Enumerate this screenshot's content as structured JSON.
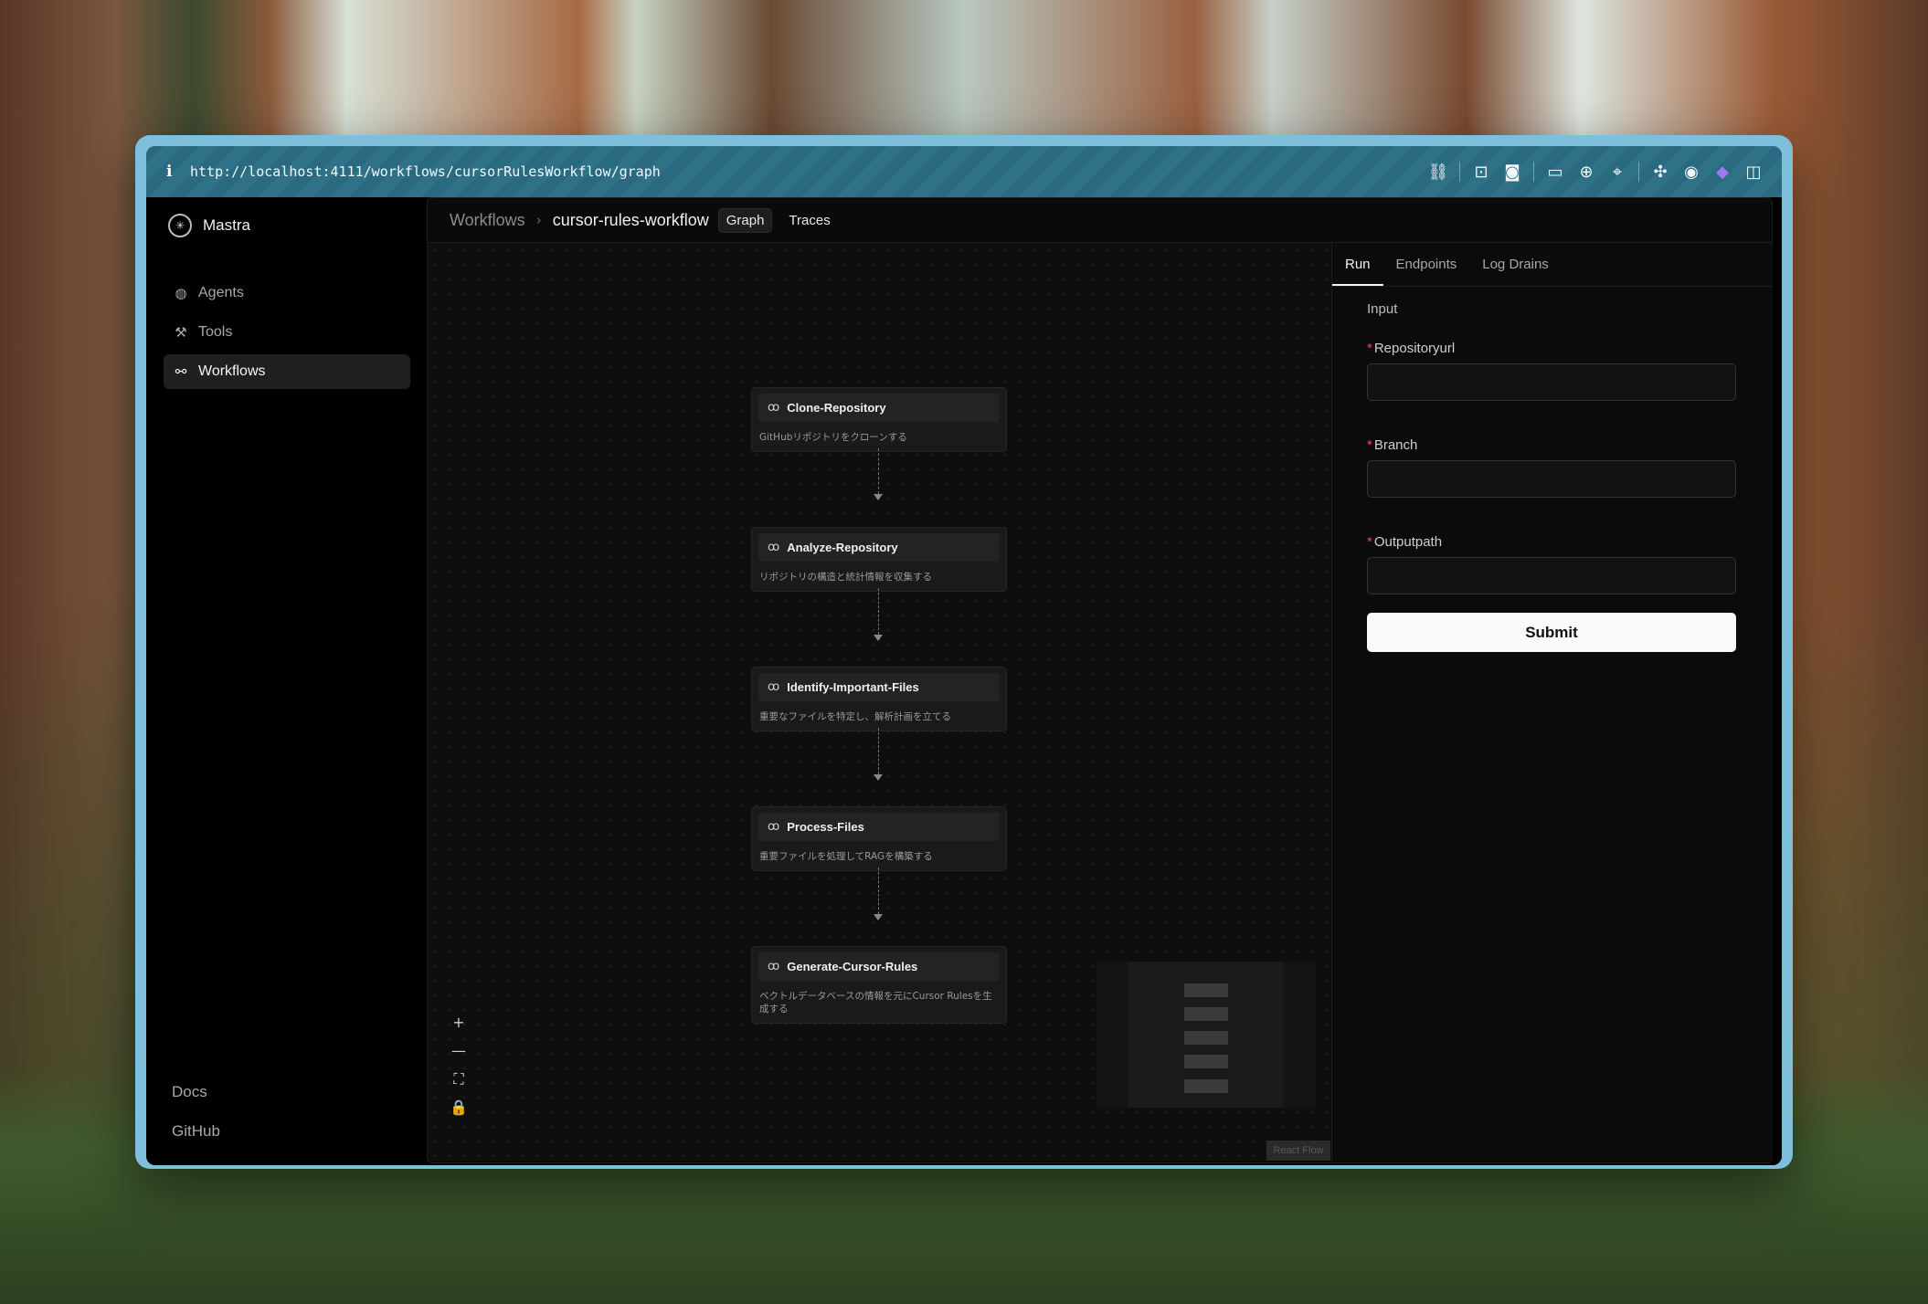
{
  "browser": {
    "url": "http://localhost:4111/workflows/cursorRulesWorkflow/graph",
    "info_icon": "i",
    "icons": [
      "link-icon",
      "download-icon",
      "camera-icon",
      "terminal-icon",
      "globe-icon",
      "crosshair-icon",
      "extensions-icon",
      "chrome-icon",
      "gem-icon",
      "split-view-icon"
    ]
  },
  "sidebar": {
    "brand": "Mastra",
    "items": [
      {
        "label": "Agents",
        "icon": "agents-icon",
        "active": false
      },
      {
        "label": "Tools",
        "icon": "tools-icon",
        "active": false
      },
      {
        "label": "Workflows",
        "icon": "workflows-icon",
        "active": true
      }
    ],
    "bottom": [
      {
        "label": "Docs"
      },
      {
        "label": "GitHub"
      }
    ]
  },
  "header": {
    "breadcrumb_root": "Workflows",
    "breadcrumb_separator": "›",
    "current": "cursor-rules-workflow",
    "tabs": [
      {
        "label": "Graph",
        "active": true
      },
      {
        "label": "Traces",
        "active": false
      }
    ]
  },
  "graph": {
    "nodes": [
      {
        "title": "Clone-Repository",
        "description": "GitHubリポジトリをクローンする"
      },
      {
        "title": "Analyze-Repository",
        "description": "リポジトリの構造と統計情報を収集する"
      },
      {
        "title": "Identify-Important-Files",
        "description": "重要なファイルを特定し、解析計画を立てる"
      },
      {
        "title": "Process-Files",
        "description": "重要ファイルを処理してRAGを構築する"
      },
      {
        "title": "Generate-Cursor-Rules",
        "description": "ベクトルデータベースの情報を元にCursor Rulesを生成する"
      }
    ],
    "controls": {
      "zoom_in": "+",
      "zoom_out": "—",
      "fit": "⛶",
      "lock": "🔒"
    },
    "attribution": "React Flow"
  },
  "panel": {
    "tabs": [
      {
        "label": "Run",
        "active": true
      },
      {
        "label": "Endpoints",
        "active": false
      },
      {
        "label": "Log Drains",
        "active": false
      }
    ],
    "form": {
      "title": "Input",
      "required_marker": "*",
      "fields": [
        {
          "label": "Repositoryurl",
          "value": ""
        },
        {
          "label": "Branch",
          "value": ""
        },
        {
          "label": "Outputpath",
          "value": ""
        }
      ],
      "submit_label": "Submit"
    }
  }
}
